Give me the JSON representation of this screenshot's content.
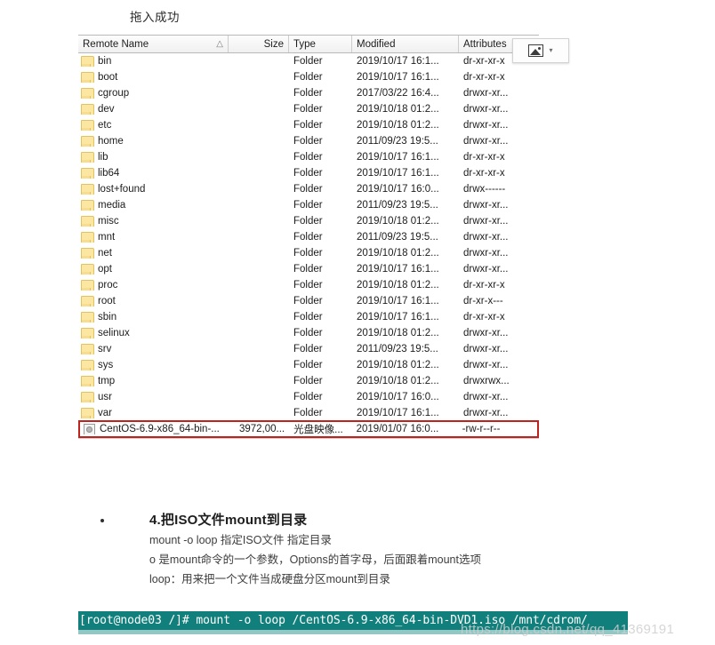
{
  "caption": {
    "drop_success": "拖入成功"
  },
  "file_panel": {
    "columns": [
      {
        "key": "name",
        "label": "Remote Name",
        "sort_indicator": "△",
        "align": "left"
      },
      {
        "key": "size",
        "label": "Size",
        "align": "right"
      },
      {
        "key": "type",
        "label": "Type",
        "align": "left"
      },
      {
        "key": "modified",
        "label": "Modified",
        "align": "left"
      },
      {
        "key": "attributes",
        "label": "Attributes",
        "align": "left"
      }
    ],
    "rows": [
      {
        "icon": "folder-icon",
        "name": "bin",
        "size": "",
        "type": "Folder",
        "modified": "2019/10/17 16:1...",
        "attributes": "dr-xr-xr-x"
      },
      {
        "icon": "folder-icon",
        "name": "boot",
        "size": "",
        "type": "Folder",
        "modified": "2019/10/17 16:1...",
        "attributes": "dr-xr-xr-x"
      },
      {
        "icon": "folder-icon",
        "name": "cgroup",
        "size": "",
        "type": "Folder",
        "modified": "2017/03/22 16:4...",
        "attributes": "drwxr-xr..."
      },
      {
        "icon": "folder-icon",
        "name": "dev",
        "size": "",
        "type": "Folder",
        "modified": "2019/10/18 01:2...",
        "attributes": "drwxr-xr..."
      },
      {
        "icon": "folder-icon",
        "name": "etc",
        "size": "",
        "type": "Folder",
        "modified": "2019/10/18 01:2...",
        "attributes": "drwxr-xr..."
      },
      {
        "icon": "folder-icon",
        "name": "home",
        "size": "",
        "type": "Folder",
        "modified": "2011/09/23 19:5...",
        "attributes": "drwxr-xr..."
      },
      {
        "icon": "folder-icon",
        "name": "lib",
        "size": "",
        "type": "Folder",
        "modified": "2019/10/17 16:1...",
        "attributes": "dr-xr-xr-x"
      },
      {
        "icon": "folder-icon",
        "name": "lib64",
        "size": "",
        "type": "Folder",
        "modified": "2019/10/17 16:1...",
        "attributes": "dr-xr-xr-x"
      },
      {
        "icon": "folder-icon",
        "name": "lost+found",
        "size": "",
        "type": "Folder",
        "modified": "2019/10/17 16:0...",
        "attributes": "drwx------"
      },
      {
        "icon": "folder-icon",
        "name": "media",
        "size": "",
        "type": "Folder",
        "modified": "2011/09/23 19:5...",
        "attributes": "drwxr-xr..."
      },
      {
        "icon": "folder-icon",
        "name": "misc",
        "size": "",
        "type": "Folder",
        "modified": "2019/10/18 01:2...",
        "attributes": "drwxr-xr..."
      },
      {
        "icon": "folder-icon",
        "name": "mnt",
        "size": "",
        "type": "Folder",
        "modified": "2011/09/23 19:5...",
        "attributes": "drwxr-xr..."
      },
      {
        "icon": "folder-icon",
        "name": "net",
        "size": "",
        "type": "Folder",
        "modified": "2019/10/18 01:2...",
        "attributes": "drwxr-xr..."
      },
      {
        "icon": "folder-icon",
        "name": "opt",
        "size": "",
        "type": "Folder",
        "modified": "2019/10/17 16:1...",
        "attributes": "drwxr-xr..."
      },
      {
        "icon": "folder-icon",
        "name": "proc",
        "size": "",
        "type": "Folder",
        "modified": "2019/10/18 01:2...",
        "attributes": "dr-xr-xr-x"
      },
      {
        "icon": "folder-icon",
        "name": "root",
        "size": "",
        "type": "Folder",
        "modified": "2019/10/17 16:1...",
        "attributes": "dr-xr-x---"
      },
      {
        "icon": "folder-icon",
        "name": "sbin",
        "size": "",
        "type": "Folder",
        "modified": "2019/10/17 16:1...",
        "attributes": "dr-xr-xr-x"
      },
      {
        "icon": "folder-icon",
        "name": "selinux",
        "size": "",
        "type": "Folder",
        "modified": "2019/10/18 01:2...",
        "attributes": "drwxr-xr..."
      },
      {
        "icon": "folder-icon",
        "name": "srv",
        "size": "",
        "type": "Folder",
        "modified": "2011/09/23 19:5...",
        "attributes": "drwxr-xr..."
      },
      {
        "icon": "folder-icon",
        "name": "sys",
        "size": "",
        "type": "Folder",
        "modified": "2019/10/18 01:2...",
        "attributes": "drwxr-xr..."
      },
      {
        "icon": "folder-icon",
        "name": "tmp",
        "size": "",
        "type": "Folder",
        "modified": "2019/10/18 01:2...",
        "attributes": "drwxrwx..."
      },
      {
        "icon": "folder-icon",
        "name": "usr",
        "size": "",
        "type": "Folder",
        "modified": "2019/10/17 16:0...",
        "attributes": "drwxr-xr..."
      },
      {
        "icon": "folder-icon",
        "name": "var",
        "size": "",
        "type": "Folder",
        "modified": "2019/10/17 16:1...",
        "attributes": "drwxr-xr..."
      }
    ],
    "highlighted_row": {
      "icon": "disc-image-icon",
      "name": "CentOS-6.9-x86_64-bin-...",
      "size": "3972,00...",
      "type": "光盘映像...",
      "modified": "2019/01/07 16:0...",
      "attributes": "-rw-r--r--",
      "highlight_color": "#c0221d"
    },
    "overlay": {
      "icon": "image-placeholder-icon",
      "caret": "▾"
    }
  },
  "notes": {
    "heading": "4.把ISO文件mount到目录",
    "lines": [
      "mount -o loop 指定ISO文件  指定目录",
      "o 是mount命令的一个参数，Options的首字母，后面跟着mount选项",
      "loop：用来把一个文件当成硬盘分区mount到目录"
    ]
  },
  "terminal": {
    "command": "[root@node03 /]# mount -o loop /CentOS-6.9-x86_64-bin-DVD1.iso /mnt/cdrom/",
    "background": "#11807c",
    "foreground": "#ffffff"
  },
  "watermark": {
    "text": "https://blog.csdn.net/qq_41369191"
  }
}
